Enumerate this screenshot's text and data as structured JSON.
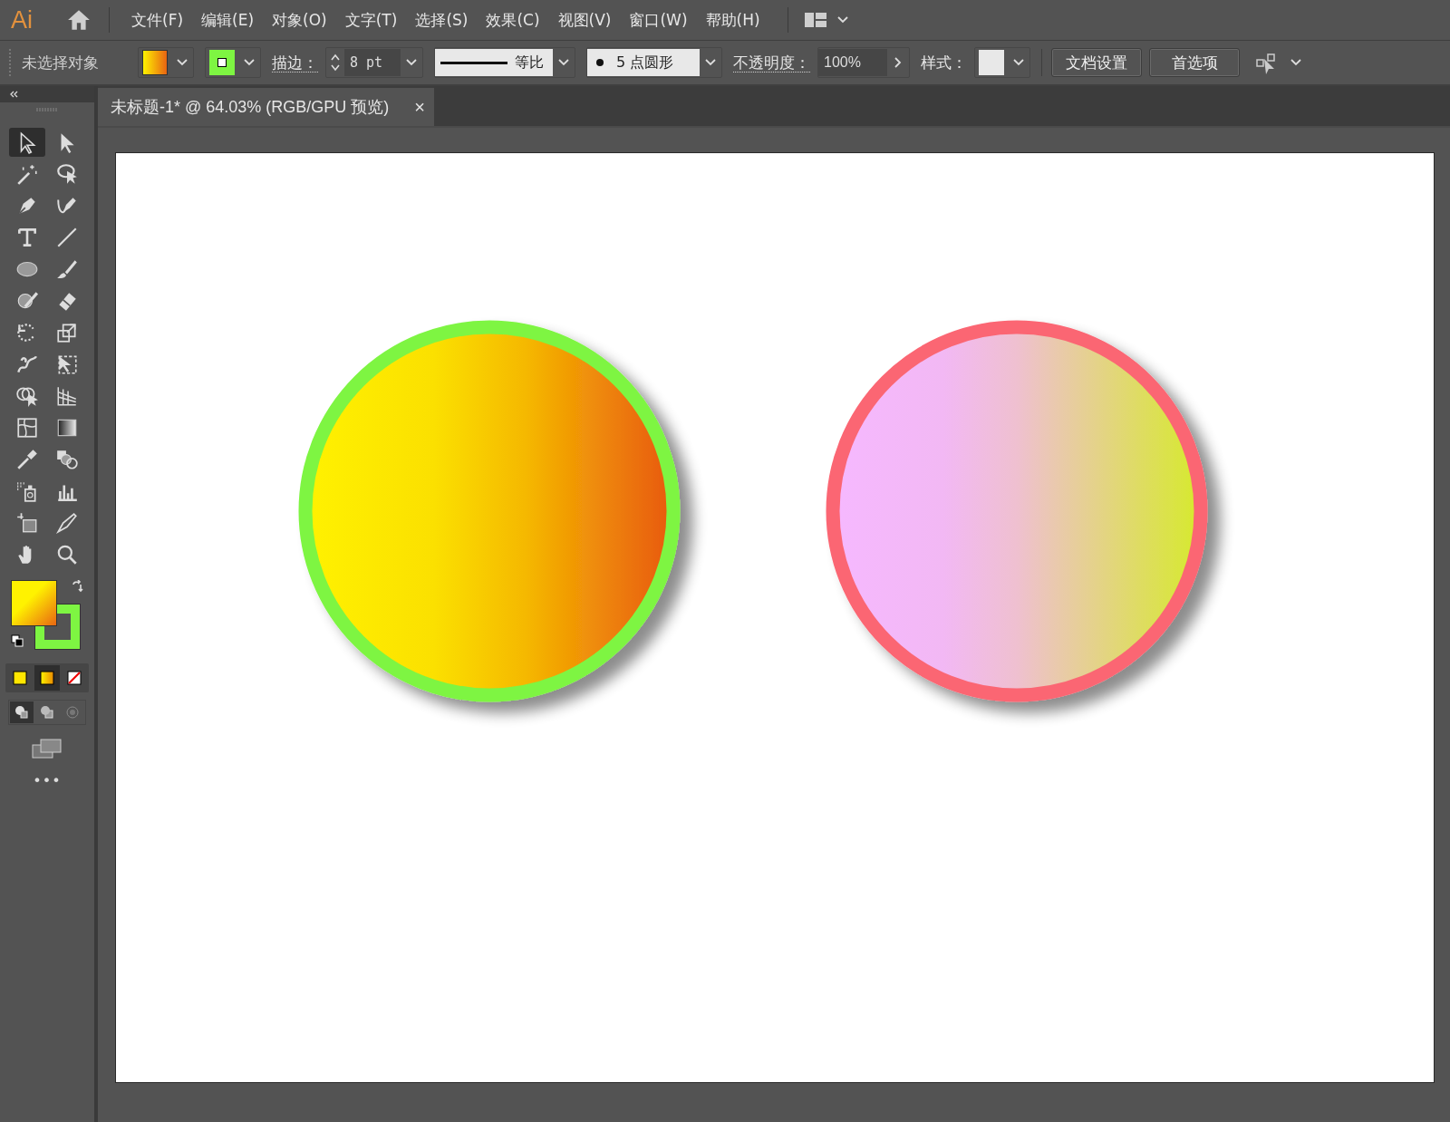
{
  "app": {
    "logo": "Ai"
  },
  "menu": [
    {
      "label": "文件(F)"
    },
    {
      "label": "编辑(E)"
    },
    {
      "label": "对象(O)"
    },
    {
      "label": "文字(T)"
    },
    {
      "label": "选择(S)"
    },
    {
      "label": "效果(C)"
    },
    {
      "label": "视图(V)"
    },
    {
      "label": "窗口(W)"
    },
    {
      "label": "帮助(H)"
    }
  ],
  "control_bar": {
    "status": "未选择对象",
    "stroke_label": "描边：",
    "stroke_weight": "8 pt",
    "stroke_profile": "等比",
    "brush": "5 点圆形",
    "opacity_label": "不透明度：",
    "opacity": "100%",
    "style_label": "样式：",
    "buttons": [
      "文档设置",
      "首选项"
    ]
  },
  "document_tab": {
    "title": "未标题-1* @ 64.03% (RGB/GPU 预览)",
    "close": "×"
  },
  "tools": [
    {
      "kind": "selection",
      "selected": true
    },
    {
      "kind": "direct",
      "selected": false
    },
    {
      "kind": "wand",
      "selected": false
    },
    {
      "kind": "lasso",
      "selected": false
    },
    {
      "kind": "pen",
      "selected": false
    },
    {
      "kind": "curvature",
      "selected": false
    },
    {
      "kind": "type",
      "selected": false
    },
    {
      "kind": "line",
      "selected": false
    },
    {
      "kind": "ellipse",
      "selected": false
    },
    {
      "kind": "brush",
      "selected": false
    },
    {
      "kind": "blob",
      "selected": false
    },
    {
      "kind": "eraser",
      "selected": false
    },
    {
      "kind": "rotate",
      "selected": false
    },
    {
      "kind": "scale",
      "selected": false
    },
    {
      "kind": "warp",
      "selected": false
    },
    {
      "kind": "transform",
      "selected": false
    },
    {
      "kind": "shapebuilder",
      "selected": false
    },
    {
      "kind": "perspective",
      "selected": false
    },
    {
      "kind": "mesh",
      "selected": false
    },
    {
      "kind": "gradient",
      "selected": false
    },
    {
      "kind": "eyedropper",
      "selected": false
    },
    {
      "kind": "blend",
      "selected": false
    },
    {
      "kind": "spray",
      "selected": false
    },
    {
      "kind": "graph",
      "selected": false
    },
    {
      "kind": "artboard",
      "selected": false
    },
    {
      "kind": "knife",
      "selected": false
    },
    {
      "kind": "hand",
      "selected": false
    },
    {
      "kind": "zoom",
      "selected": false
    }
  ],
  "fill_modes": [
    {
      "kind": "color",
      "selected": false
    },
    {
      "kind": "gradient",
      "selected": true
    },
    {
      "kind": "none",
      "selected": false
    }
  ],
  "draw_modes": [
    {
      "selected": true
    },
    {
      "selected": false
    },
    {
      "selected": false
    }
  ],
  "more_tools": "•••"
}
